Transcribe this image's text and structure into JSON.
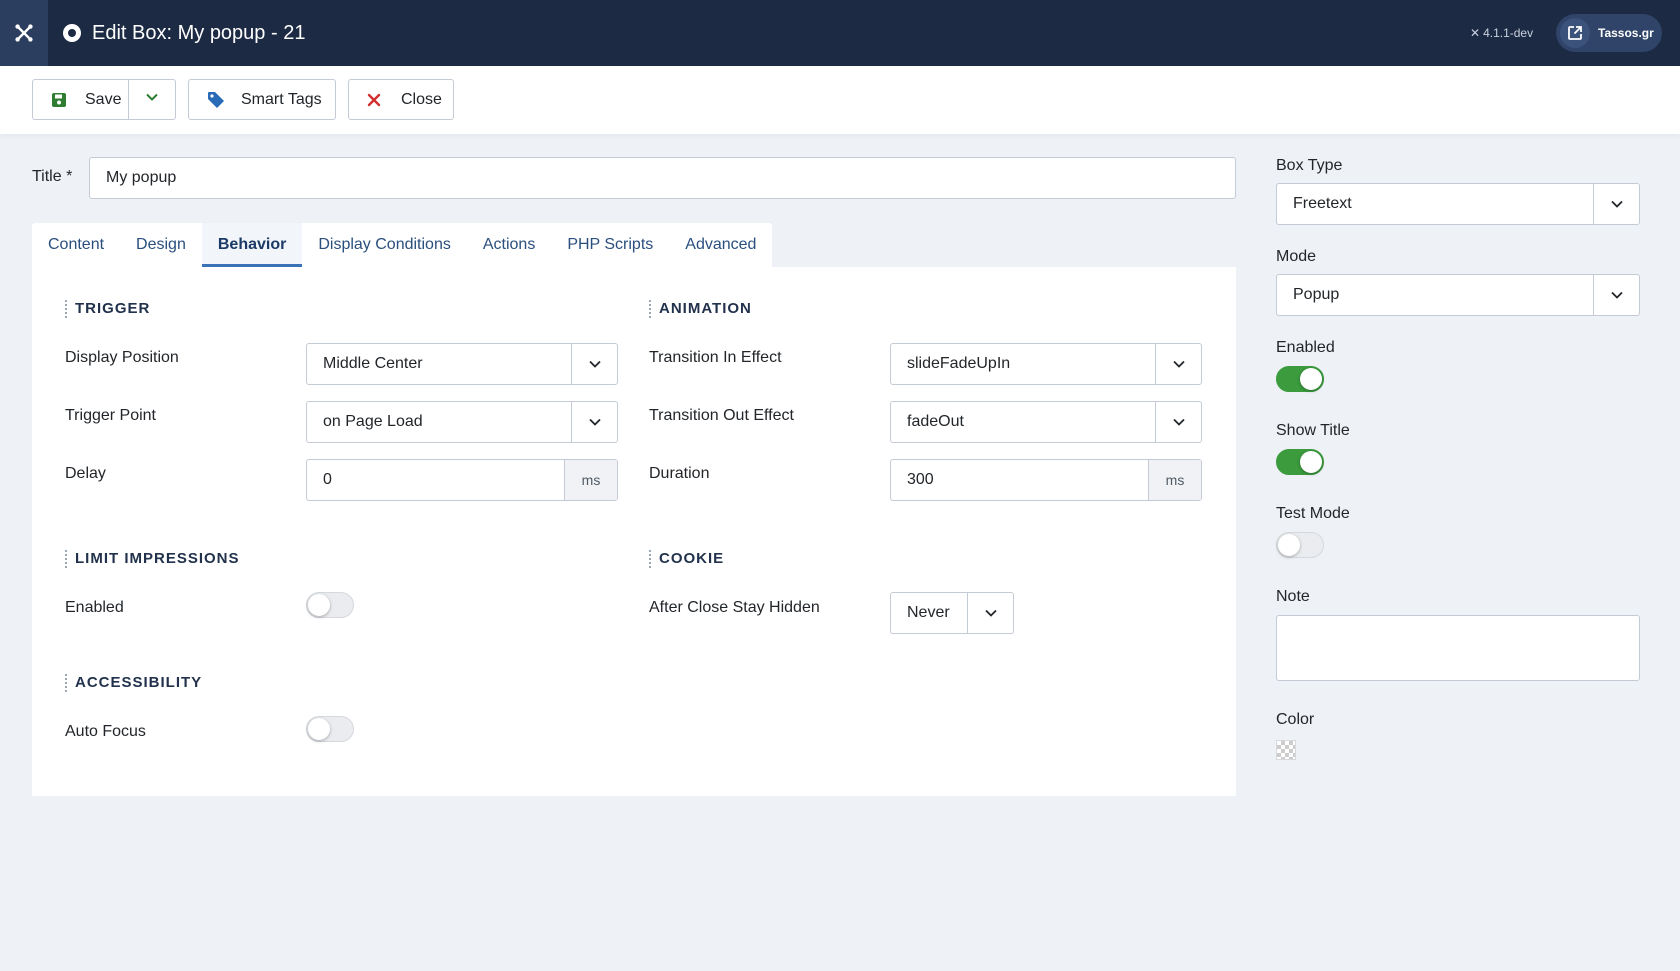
{
  "header": {
    "title": "Edit Box: My popup - 21",
    "version": "4.1.1-dev",
    "site_link": "Tassos.gr"
  },
  "toolbar": {
    "save": "Save",
    "smart_tags": "Smart Tags",
    "close": "Close"
  },
  "form": {
    "title_label": "Title *",
    "title_value": "My popup"
  },
  "tabs": [
    "Content",
    "Design",
    "Behavior",
    "Display Conditions",
    "Actions",
    "PHP Scripts",
    "Advanced"
  ],
  "active_tab": "Behavior",
  "trigger": {
    "heading": "TRIGGER",
    "display_position_label": "Display Position",
    "display_position_value": "Middle Center",
    "trigger_point_label": "Trigger Point",
    "trigger_point_value": "on Page Load",
    "delay_label": "Delay",
    "delay_value": "0",
    "delay_unit": "ms"
  },
  "animation": {
    "heading": "ANIMATION",
    "in_label": "Transition In Effect",
    "in_value": "slideFadeUpIn",
    "out_label": "Transition Out Effect",
    "out_value": "fadeOut",
    "duration_label": "Duration",
    "duration_value": "300",
    "duration_unit": "ms"
  },
  "limit": {
    "heading": "LIMIT IMPRESSIONS",
    "enabled_label": "Enabled",
    "enabled": false
  },
  "cookie": {
    "heading": "COOKIE",
    "label": "After Close Stay Hidden",
    "value": "Never"
  },
  "accessibility": {
    "heading": "ACCESSIBILITY",
    "auto_focus_label": "Auto Focus",
    "auto_focus": false
  },
  "sidebar": {
    "box_type_label": "Box Type",
    "box_type_value": "Freetext",
    "mode_label": "Mode",
    "mode_value": "Popup",
    "enabled_label": "Enabled",
    "enabled": true,
    "show_title_label": "Show Title",
    "show_title": true,
    "test_mode_label": "Test Mode",
    "test_mode": false,
    "note_label": "Note",
    "note_value": "",
    "color_label": "Color"
  },
  "colors": {
    "header_bg": "#1c2a44",
    "toggle_on": "#3b9b3d",
    "tab_accent": "#3a72b8"
  }
}
